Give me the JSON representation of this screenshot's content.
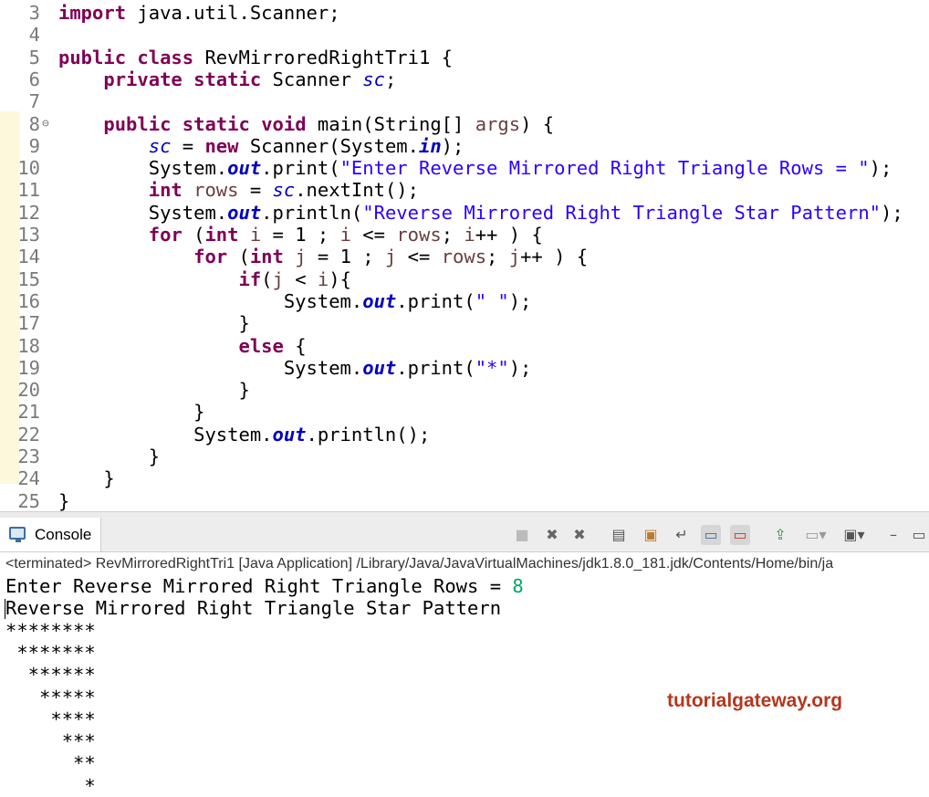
{
  "editor": {
    "lines": [
      {
        "n": "3",
        "segs": [
          [
            "kw",
            "import"
          ],
          [
            "plain",
            " java.util.Scanner;"
          ]
        ]
      },
      {
        "n": "4",
        "segs": []
      },
      {
        "n": "5",
        "segs": [
          [
            "kw",
            "public"
          ],
          [
            "plain",
            " "
          ],
          [
            "kw",
            "class"
          ],
          [
            "plain",
            " RevMirroredRightTri1 {"
          ]
        ]
      },
      {
        "n": "6",
        "segs": [
          [
            "plain",
            "    "
          ],
          [
            "kw",
            "private"
          ],
          [
            "plain",
            " "
          ],
          [
            "kw",
            "static"
          ],
          [
            "plain",
            " Scanner "
          ],
          [
            "fld",
            "sc"
          ],
          [
            "plain",
            ";"
          ]
        ]
      },
      {
        "n": "7",
        "segs": []
      },
      {
        "n": "8",
        "fold": "⊖",
        "segs": [
          [
            "plain",
            "    "
          ],
          [
            "kw",
            "public"
          ],
          [
            "plain",
            " "
          ],
          [
            "kw",
            "static"
          ],
          [
            "plain",
            " "
          ],
          [
            "kw",
            "void"
          ],
          [
            "plain",
            " main(String[] "
          ],
          [
            "var",
            "args"
          ],
          [
            "plain",
            ") {"
          ]
        ]
      },
      {
        "n": "9",
        "segs": [
          [
            "plain",
            "        "
          ],
          [
            "fld",
            "sc"
          ],
          [
            "plain",
            " = "
          ],
          [
            "kw",
            "new"
          ],
          [
            "plain",
            " Scanner(System."
          ],
          [
            "sfld",
            "in"
          ],
          [
            "plain",
            ");"
          ]
        ]
      },
      {
        "n": "10",
        "segs": [
          [
            "plain",
            "        System."
          ],
          [
            "sfld",
            "out"
          ],
          [
            "plain",
            ".print("
          ],
          [
            "str",
            "\"Enter Reverse Mirrored Right Triangle Rows = \""
          ],
          [
            "plain",
            ");"
          ]
        ]
      },
      {
        "n": "11",
        "segs": [
          [
            "plain",
            "        "
          ],
          [
            "kw",
            "int"
          ],
          [
            "plain",
            " "
          ],
          [
            "var",
            "rows"
          ],
          [
            "plain",
            " = "
          ],
          [
            "fld",
            "sc"
          ],
          [
            "plain",
            ".nextInt();"
          ]
        ]
      },
      {
        "n": "12",
        "segs": [
          [
            "plain",
            "        System."
          ],
          [
            "sfld",
            "out"
          ],
          [
            "plain",
            ".println("
          ],
          [
            "str",
            "\"Reverse Mirrored Right Triangle Star Pattern\""
          ],
          [
            "plain",
            ");"
          ]
        ]
      },
      {
        "n": "13",
        "segs": [
          [
            "plain",
            "        "
          ],
          [
            "kw",
            "for"
          ],
          [
            "plain",
            " ("
          ],
          [
            "kw",
            "int"
          ],
          [
            "plain",
            " "
          ],
          [
            "var",
            "i"
          ],
          [
            "plain",
            " = 1 ; "
          ],
          [
            "var",
            "i"
          ],
          [
            "plain",
            " <= "
          ],
          [
            "var",
            "rows"
          ],
          [
            "plain",
            "; "
          ],
          [
            "var",
            "i"
          ],
          [
            "plain",
            "++ ) {"
          ]
        ]
      },
      {
        "n": "14",
        "segs": [
          [
            "plain",
            "            "
          ],
          [
            "kw",
            "for"
          ],
          [
            "plain",
            " ("
          ],
          [
            "kw",
            "int"
          ],
          [
            "plain",
            " "
          ],
          [
            "var",
            "j"
          ],
          [
            "plain",
            " = 1 ; "
          ],
          [
            "var",
            "j"
          ],
          [
            "plain",
            " <= "
          ],
          [
            "var",
            "rows"
          ],
          [
            "plain",
            "; "
          ],
          [
            "var",
            "j"
          ],
          [
            "plain",
            "++ ) {"
          ]
        ]
      },
      {
        "n": "15",
        "segs": [
          [
            "plain",
            "                "
          ],
          [
            "kw",
            "if"
          ],
          [
            "plain",
            "("
          ],
          [
            "var",
            "j"
          ],
          [
            "plain",
            " < "
          ],
          [
            "var",
            "i"
          ],
          [
            "plain",
            "){"
          ]
        ]
      },
      {
        "n": "16",
        "segs": [
          [
            "plain",
            "                    System."
          ],
          [
            "sfld",
            "out"
          ],
          [
            "plain",
            ".print("
          ],
          [
            "str",
            "\" \""
          ],
          [
            "plain",
            ");"
          ]
        ]
      },
      {
        "n": "17",
        "segs": [
          [
            "plain",
            "                }"
          ]
        ]
      },
      {
        "n": "18",
        "segs": [
          [
            "plain",
            "                "
          ],
          [
            "kw",
            "else"
          ],
          [
            "plain",
            " {"
          ]
        ]
      },
      {
        "n": "19",
        "segs": [
          [
            "plain",
            "                    System."
          ],
          [
            "sfld",
            "out"
          ],
          [
            "plain",
            ".print("
          ],
          [
            "str",
            "\"*\""
          ],
          [
            "plain",
            ");"
          ]
        ]
      },
      {
        "n": "20",
        "segs": [
          [
            "plain",
            "                }"
          ]
        ]
      },
      {
        "n": "21",
        "segs": [
          [
            "plain",
            "            }"
          ]
        ]
      },
      {
        "n": "22",
        "segs": [
          [
            "plain",
            "            System."
          ],
          [
            "sfld",
            "out"
          ],
          [
            "plain",
            ".println();"
          ]
        ]
      },
      {
        "n": "23",
        "segs": [
          [
            "plain",
            "        }"
          ]
        ]
      },
      {
        "n": "24",
        "segs": [
          [
            "plain",
            "    }"
          ]
        ]
      },
      {
        "n": "25",
        "segs": [
          [
            "plain",
            "}"
          ]
        ]
      }
    ]
  },
  "console": {
    "tab_label": "Console",
    "status": "<terminated> RevMirroredRightTri1 [Java Application] /Library/Java/JavaVirtualMachines/jdk1.8.0_181.jdk/Contents/Home/bin/ja",
    "prompt_text": "Enter Reverse Mirrored Right Triangle Rows = ",
    "prompt_input": "8",
    "output_lines": [
      "Reverse Mirrored Right Triangle Star Pattern",
      "********",
      " *******",
      "  ******",
      "   *****",
      "    ****",
      "     ***",
      "      **",
      "       *"
    ]
  },
  "toolbar": {
    "icons": [
      "stop-icon",
      "remove-launch-icon",
      "remove-all-terminated-icon",
      "clear-console-icon",
      "scroll-lock-icon",
      "word-wrap-icon",
      "show-on-stdout-icon",
      "show-on-stderr-icon",
      "pin-console-icon",
      "display-selected-console-icon",
      "open-console-icon",
      "minimize-icon",
      "maximize-icon"
    ]
  },
  "watermark": {
    "text": "tutorialgateway.org"
  }
}
